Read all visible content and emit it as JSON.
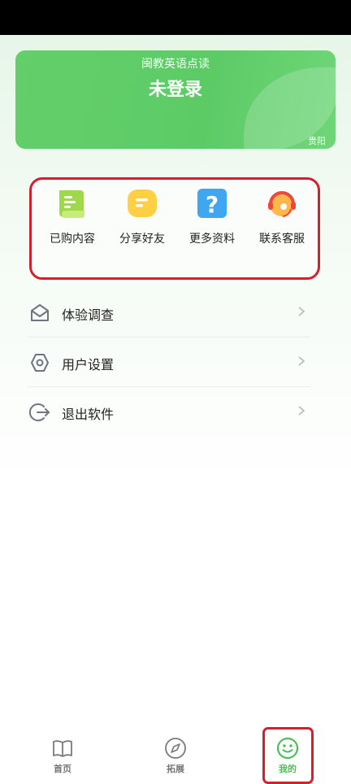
{
  "banner": {
    "app_name": "闽教英语点读",
    "login_status": "未登录",
    "city": "贵阳"
  },
  "quick_actions": [
    {
      "label": "已购内容",
      "icon": "purchased-content-icon"
    },
    {
      "label": "分享好友",
      "icon": "share-friends-icon"
    },
    {
      "label": "更多资料",
      "icon": "more-materials-icon"
    },
    {
      "label": "联系客服",
      "icon": "customer-service-icon"
    }
  ],
  "menu": [
    {
      "label": "体验调查",
      "icon": "envelope-icon"
    },
    {
      "label": "用户设置",
      "icon": "hexagon-settings-icon"
    },
    {
      "label": "退出软件",
      "icon": "logout-icon"
    }
  ],
  "tabs": [
    {
      "label": "首页",
      "icon": "book-icon",
      "active": false
    },
    {
      "label": "拓展",
      "icon": "compass-icon",
      "active": false
    },
    {
      "label": "我的",
      "icon": "smiley-icon",
      "active": true
    }
  ],
  "colors": {
    "brand_green": "#5ccb66",
    "active_tab": "#4fbd5a",
    "highlight_red": "#d61f2c"
  }
}
